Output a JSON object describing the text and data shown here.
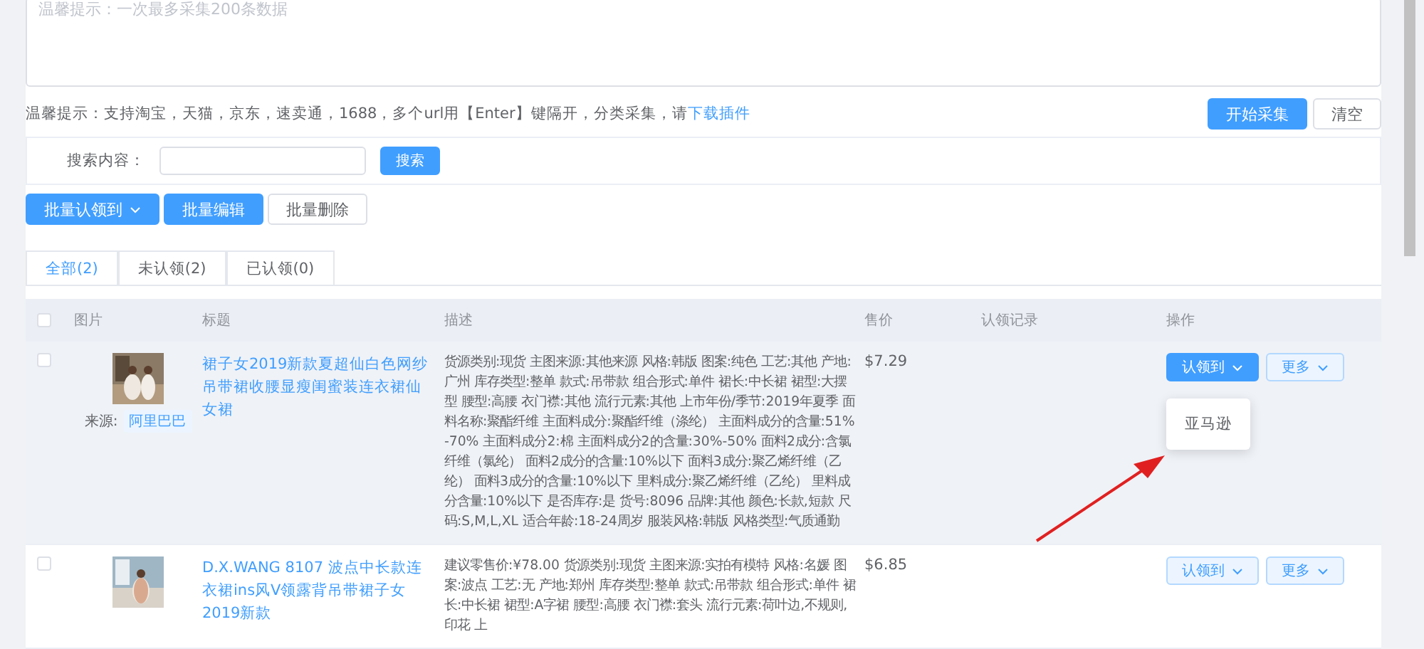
{
  "collect_box": {
    "placeholder": "温馨提示：一次最多采集200条数据"
  },
  "hint": {
    "text": "温馨提示：支持淘宝，天猫，京东，速卖通，1688，多个url用【Enter】键隔开，分类采集，请",
    "link": "下载插件"
  },
  "collect_buttons": [
    {
      "label": "开始采集",
      "kind": "primary"
    },
    {
      "label": "清空",
      "kind": "plain"
    }
  ],
  "search": {
    "label": "搜索内容：",
    "button": "搜索"
  },
  "batch_buttons": [
    {
      "label": "批量认领到",
      "kind": "primary",
      "caret": true
    },
    {
      "label": "批量编辑",
      "kind": "primary",
      "caret": false
    },
    {
      "label": "批量删除",
      "kind": "plain",
      "caret": false
    }
  ],
  "tabs": [
    {
      "label": "全部(2)",
      "selected": true
    },
    {
      "label": "未认领(2)",
      "selected": false
    },
    {
      "label": "已认领(0)",
      "selected": false
    }
  ],
  "table": {
    "select_all": {
      "checked": false
    },
    "columns": [
      "图片",
      "标题",
      "描述",
      "售价",
      "认领记录",
      "操作"
    ],
    "rows": [
      {
        "checked": false,
        "hovered": true,
        "source_label": "来源:",
        "source": "阿里巴巴",
        "title": "裙子女2019新款夏超仙白色网纱吊带裙收腰显瘦闺蜜装连衣裙仙女裙",
        "description": "货源类别:现货 主图来源:其他来源 风格:韩版 图案:纯色 工艺:其他 产地:广州 库存类型:整单 款式:吊带款 组合形式:单件 裙长:中长裙 裙型:大摆型 腰型:高腰 衣门襟:其他 流行元素:其他 上市年份/季节:2019年夏季 面料名称:聚酯纤维 主面料成分:聚酯纤维（涤纶） 主面料成分的含量:51%-70% 主面料成分2:棉 主面料成分2的含量:30%-50% 面料2成分:含氯纤维（氯纶） 面料2成分的含量:10%以下 面料3成分:聚乙烯纤维（乙纶） 面料3成分的含量:10%以下 里料成分:聚乙烯纤维（乙纶） 里料成分含量:10%以下 是否库存:是 货号:8096 品牌:其他 颜色:长款,短款 尺码:S,M,L,XL 适合年龄:18-24周岁 服装风格:韩版 风格类型:气质通勤",
        "price": "$7.29",
        "actions": [
          {
            "label": "认领到",
            "kind": "primary"
          },
          {
            "label": "更多",
            "kind": "light"
          }
        ],
        "menu": [
          "亚马逊"
        ]
      },
      {
        "checked": false,
        "hovered": false,
        "title": "D.X.WANG 8107 波点中长款连衣裙ins风V领露背吊带裙子女2019新款",
        "description": "建议零售价:¥78.00 货源类别:现货 主图来源:实拍有模特 风格:名媛 图案:波点 工艺:无 产地:郑州 库存类型:整单 款式:吊带款 组合形式:单件 裙长:中长裙 裙型:A字裙 腰型:高腰 衣门襟:套头 流行元素:荷叶边,不规则,印花 上",
        "price": "$6.85",
        "actions": [
          {
            "label": "认领到",
            "kind": "light"
          },
          {
            "label": "更多",
            "kind": "light"
          }
        ]
      }
    ]
  }
}
